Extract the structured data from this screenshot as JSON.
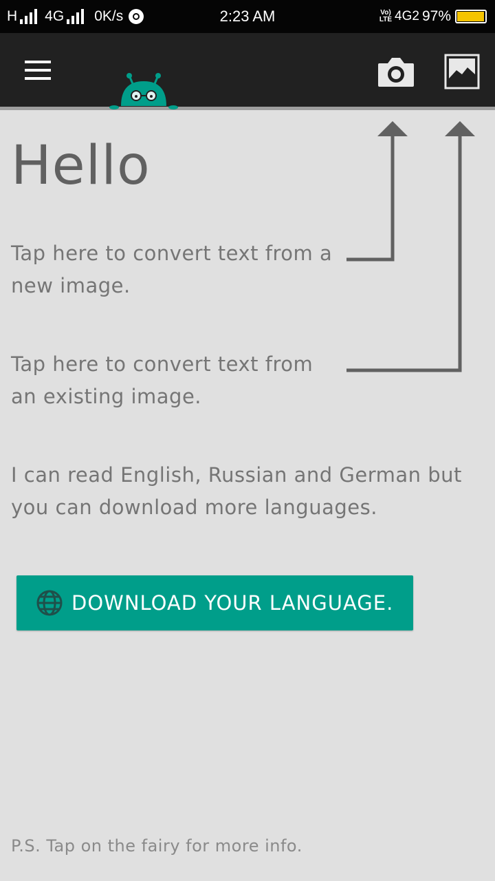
{
  "status_bar": {
    "network_left": "H",
    "network_type": "4G",
    "speed": "0K/s",
    "time": "2:23 AM",
    "volte_top": "Vo)",
    "volte_bottom": "LTE",
    "network_right": "4G2",
    "battery_percent": "97%",
    "battery_level": 0.97,
    "battery_color": "#f5c400"
  },
  "toolbar": {
    "menu_icon": "hamburger-menu-icon",
    "fairy_icon": "robot-fairy-icon",
    "camera_icon": "camera-icon",
    "gallery_icon": "image-gallery-icon",
    "background_color": "#212121"
  },
  "main": {
    "greeting": "Hello",
    "hint_camera": "Tap here to convert text from a new image.",
    "hint_gallery": "Tap here to convert text from an existing image.",
    "hint_languages": "I can read English, Russian and German but you can download more languages.",
    "download_button": {
      "label": "DOWNLOAD YOUR LANGUAGE.",
      "icon": "globe-icon",
      "color": "#009e8a"
    },
    "ps_note": "P.S. Tap on the fairy for more info."
  }
}
